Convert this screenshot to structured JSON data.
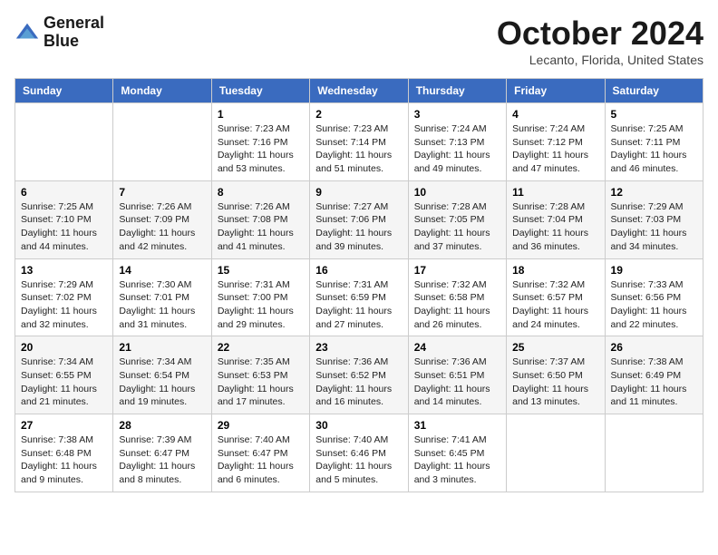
{
  "header": {
    "logo_line1": "General",
    "logo_line2": "Blue",
    "month_title": "October 2024",
    "location": "Lecanto, Florida, United States"
  },
  "days_of_week": [
    "Sunday",
    "Monday",
    "Tuesday",
    "Wednesday",
    "Thursday",
    "Friday",
    "Saturday"
  ],
  "weeks": [
    [
      {
        "day": "",
        "info": ""
      },
      {
        "day": "",
        "info": ""
      },
      {
        "day": "1",
        "info": "Sunrise: 7:23 AM\nSunset: 7:16 PM\nDaylight: 11 hours and 53 minutes."
      },
      {
        "day": "2",
        "info": "Sunrise: 7:23 AM\nSunset: 7:14 PM\nDaylight: 11 hours and 51 minutes."
      },
      {
        "day": "3",
        "info": "Sunrise: 7:24 AM\nSunset: 7:13 PM\nDaylight: 11 hours and 49 minutes."
      },
      {
        "day": "4",
        "info": "Sunrise: 7:24 AM\nSunset: 7:12 PM\nDaylight: 11 hours and 47 minutes."
      },
      {
        "day": "5",
        "info": "Sunrise: 7:25 AM\nSunset: 7:11 PM\nDaylight: 11 hours and 46 minutes."
      }
    ],
    [
      {
        "day": "6",
        "info": "Sunrise: 7:25 AM\nSunset: 7:10 PM\nDaylight: 11 hours and 44 minutes."
      },
      {
        "day": "7",
        "info": "Sunrise: 7:26 AM\nSunset: 7:09 PM\nDaylight: 11 hours and 42 minutes."
      },
      {
        "day": "8",
        "info": "Sunrise: 7:26 AM\nSunset: 7:08 PM\nDaylight: 11 hours and 41 minutes."
      },
      {
        "day": "9",
        "info": "Sunrise: 7:27 AM\nSunset: 7:06 PM\nDaylight: 11 hours and 39 minutes."
      },
      {
        "day": "10",
        "info": "Sunrise: 7:28 AM\nSunset: 7:05 PM\nDaylight: 11 hours and 37 minutes."
      },
      {
        "day": "11",
        "info": "Sunrise: 7:28 AM\nSunset: 7:04 PM\nDaylight: 11 hours and 36 minutes."
      },
      {
        "day": "12",
        "info": "Sunrise: 7:29 AM\nSunset: 7:03 PM\nDaylight: 11 hours and 34 minutes."
      }
    ],
    [
      {
        "day": "13",
        "info": "Sunrise: 7:29 AM\nSunset: 7:02 PM\nDaylight: 11 hours and 32 minutes."
      },
      {
        "day": "14",
        "info": "Sunrise: 7:30 AM\nSunset: 7:01 PM\nDaylight: 11 hours and 31 minutes."
      },
      {
        "day": "15",
        "info": "Sunrise: 7:31 AM\nSunset: 7:00 PM\nDaylight: 11 hours and 29 minutes."
      },
      {
        "day": "16",
        "info": "Sunrise: 7:31 AM\nSunset: 6:59 PM\nDaylight: 11 hours and 27 minutes."
      },
      {
        "day": "17",
        "info": "Sunrise: 7:32 AM\nSunset: 6:58 PM\nDaylight: 11 hours and 26 minutes."
      },
      {
        "day": "18",
        "info": "Sunrise: 7:32 AM\nSunset: 6:57 PM\nDaylight: 11 hours and 24 minutes."
      },
      {
        "day": "19",
        "info": "Sunrise: 7:33 AM\nSunset: 6:56 PM\nDaylight: 11 hours and 22 minutes."
      }
    ],
    [
      {
        "day": "20",
        "info": "Sunrise: 7:34 AM\nSunset: 6:55 PM\nDaylight: 11 hours and 21 minutes."
      },
      {
        "day": "21",
        "info": "Sunrise: 7:34 AM\nSunset: 6:54 PM\nDaylight: 11 hours and 19 minutes."
      },
      {
        "day": "22",
        "info": "Sunrise: 7:35 AM\nSunset: 6:53 PM\nDaylight: 11 hours and 17 minutes."
      },
      {
        "day": "23",
        "info": "Sunrise: 7:36 AM\nSunset: 6:52 PM\nDaylight: 11 hours and 16 minutes."
      },
      {
        "day": "24",
        "info": "Sunrise: 7:36 AM\nSunset: 6:51 PM\nDaylight: 11 hours and 14 minutes."
      },
      {
        "day": "25",
        "info": "Sunrise: 7:37 AM\nSunset: 6:50 PM\nDaylight: 11 hours and 13 minutes."
      },
      {
        "day": "26",
        "info": "Sunrise: 7:38 AM\nSunset: 6:49 PM\nDaylight: 11 hours and 11 minutes."
      }
    ],
    [
      {
        "day": "27",
        "info": "Sunrise: 7:38 AM\nSunset: 6:48 PM\nDaylight: 11 hours and 9 minutes."
      },
      {
        "day": "28",
        "info": "Sunrise: 7:39 AM\nSunset: 6:47 PM\nDaylight: 11 hours and 8 minutes."
      },
      {
        "day": "29",
        "info": "Sunrise: 7:40 AM\nSunset: 6:47 PM\nDaylight: 11 hours and 6 minutes."
      },
      {
        "day": "30",
        "info": "Sunrise: 7:40 AM\nSunset: 6:46 PM\nDaylight: 11 hours and 5 minutes."
      },
      {
        "day": "31",
        "info": "Sunrise: 7:41 AM\nSunset: 6:45 PM\nDaylight: 11 hours and 3 minutes."
      },
      {
        "day": "",
        "info": ""
      },
      {
        "day": "",
        "info": ""
      }
    ]
  ]
}
